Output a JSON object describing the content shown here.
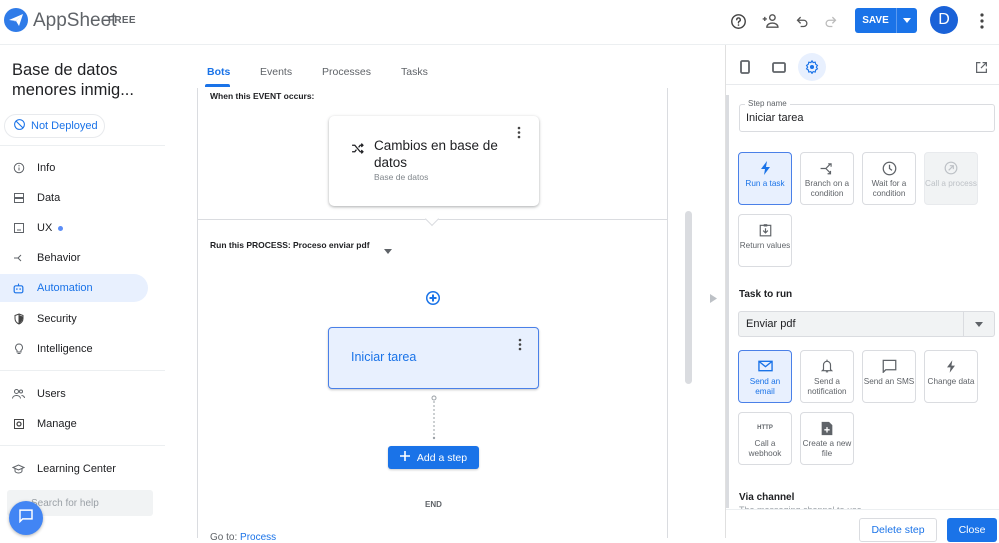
{
  "header": {
    "brand": "AppSheet",
    "plan_badge": "FREE",
    "save_label": "SAVE",
    "avatar_initial": "D",
    "icons": [
      "help-icon",
      "share-user-icon",
      "undo-icon",
      "redo-icon",
      "save-dropdown-icon",
      "more-vert-icon"
    ]
  },
  "sidebar": {
    "app_name": "Base de datos menores inmig...",
    "deploy_status": "Not Deployed",
    "items": [
      {
        "label": "Info",
        "icon": "info-icon"
      },
      {
        "label": "Data",
        "icon": "data-icon"
      },
      {
        "label": "UX",
        "icon": "ux-icon",
        "has_dot": true
      },
      {
        "label": "Behavior",
        "icon": "behavior-icon"
      },
      {
        "label": "Automation",
        "icon": "automation-icon",
        "active": true
      },
      {
        "label": "Security",
        "icon": "security-icon"
      },
      {
        "label": "Intelligence",
        "icon": "intelligence-icon"
      },
      {
        "label": "Users",
        "icon": "users-icon"
      },
      {
        "label": "Manage",
        "icon": "manage-icon"
      },
      {
        "label": "Learning Center",
        "icon": "learning-center-icon"
      }
    ],
    "help_search_placeholder": "Search for help"
  },
  "main": {
    "tabs": [
      {
        "label": "Bots",
        "active": true
      },
      {
        "label": "Events"
      },
      {
        "label": "Processes"
      },
      {
        "label": "Tasks"
      }
    ],
    "event_label": "When this EVENT occurs:",
    "event_card": {
      "title": "Cambios en base de datos",
      "subtitle": "Base de datos"
    },
    "process_label": "Run this PROCESS:",
    "process_value": "Proceso enviar pdf",
    "step_card": {
      "title": "Iniciar tarea"
    },
    "add_step_label": "Add a step",
    "end_label": "END",
    "goto_prefix": "Go to:",
    "goto_link": "Process"
  },
  "panel": {
    "step_name_label": "Step name",
    "step_name_value": "Iniciar tarea",
    "step_types": [
      {
        "label": "Run a task",
        "icon": "bolt-icon",
        "state": "selected"
      },
      {
        "label": "Branch on a condition",
        "icon": "branch-icon",
        "state": "normal"
      },
      {
        "label": "Wait for a condition",
        "icon": "clock-icon",
        "state": "normal"
      },
      {
        "label": "Call a process",
        "icon": "call-process-icon",
        "state": "disabled"
      },
      {
        "label": "Return values",
        "icon": "return-values-icon",
        "state": "normal"
      }
    ],
    "task_to_run_label": "Task to run",
    "task_to_run_value": "Enviar pdf",
    "task_types": [
      {
        "label": "Send an email",
        "icon": "email-icon",
        "state": "selected"
      },
      {
        "label": "Send a notification",
        "icon": "bell-icon",
        "state": "normal"
      },
      {
        "label": "Send an SMS",
        "icon": "sms-icon",
        "state": "normal"
      },
      {
        "label": "Change data",
        "icon": "bolt-icon",
        "state": "normal"
      },
      {
        "label": "Call a webhook",
        "icon": "http-icon",
        "icon_text": "HTTP",
        "state": "normal"
      },
      {
        "label": "Create a new file",
        "icon": "new-file-icon",
        "state": "normal"
      }
    ],
    "via_channel_label": "Via channel",
    "via_channel_desc": "The messaging channel to use",
    "delete_label": "Delete step",
    "close_label": "Close"
  },
  "colors": {
    "accent": "#1a73e8",
    "selected_bg": "#e8f0fe",
    "active_nav_bg": "#e8f0fe"
  }
}
